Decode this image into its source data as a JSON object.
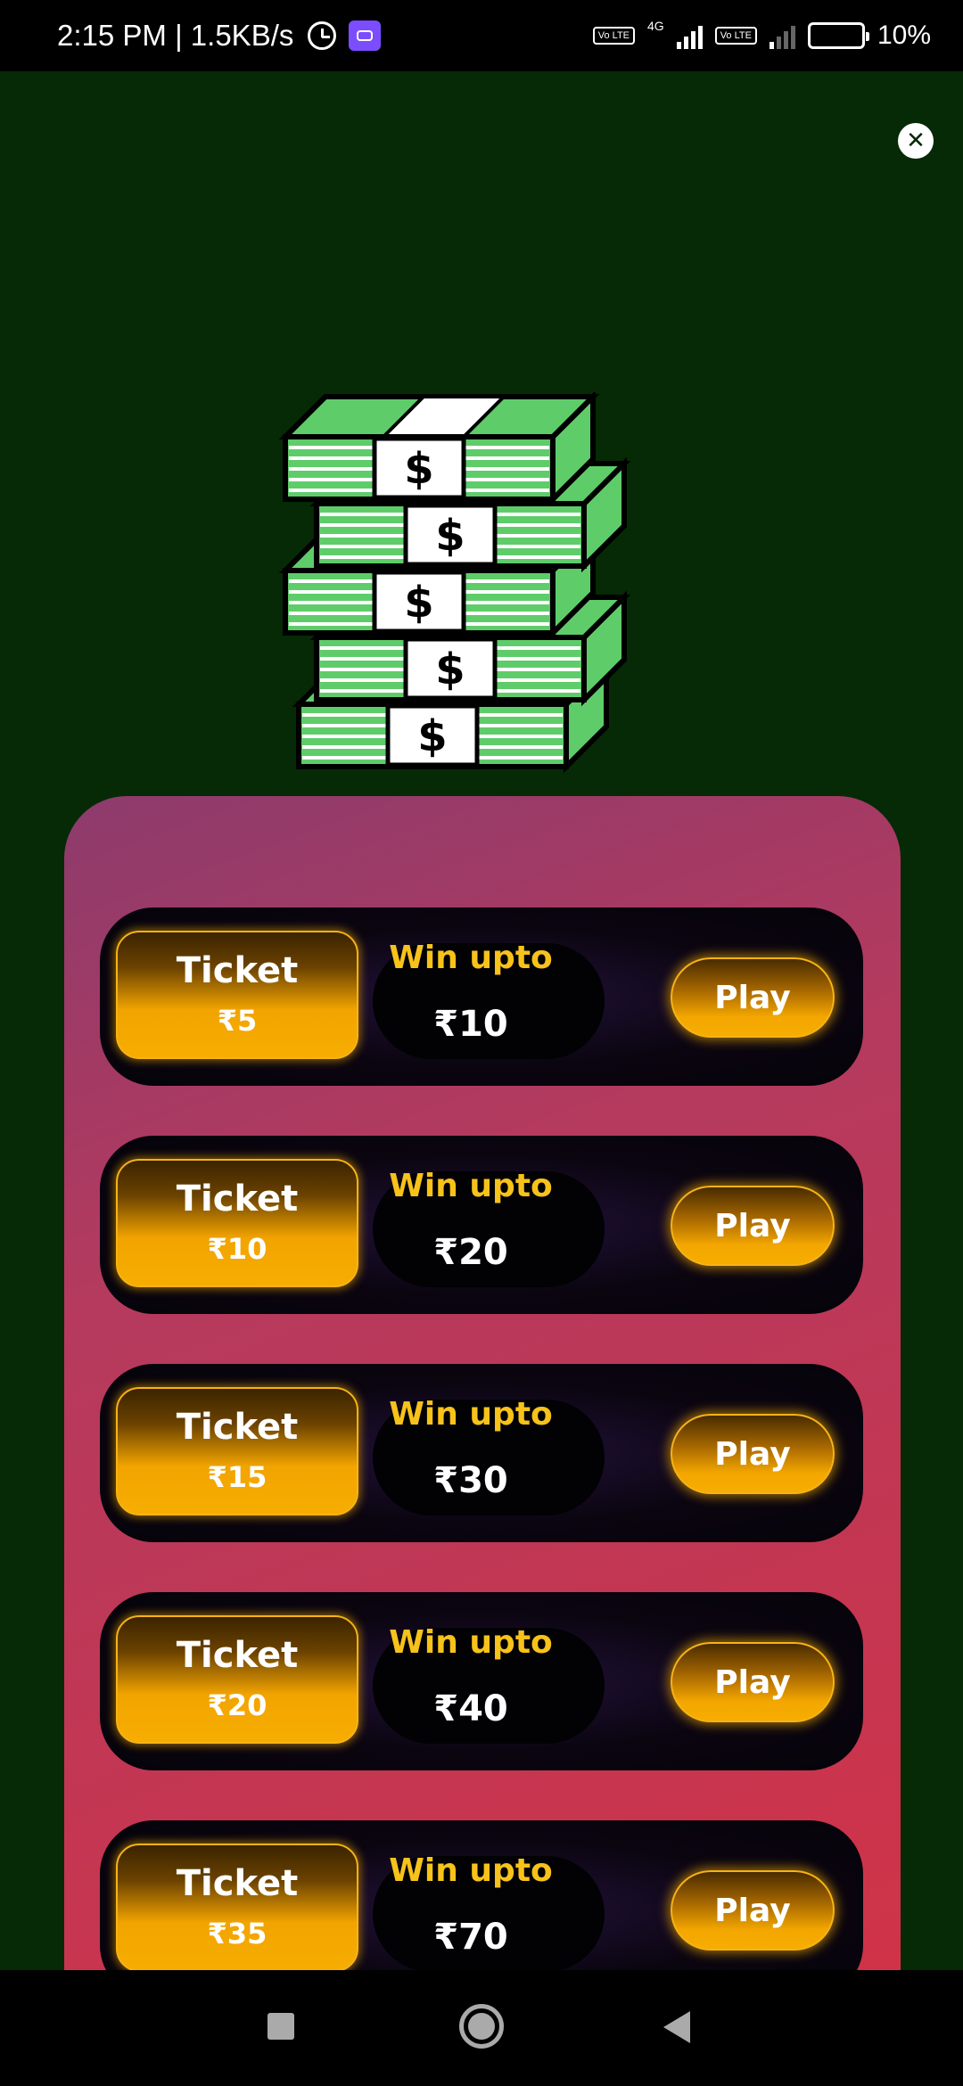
{
  "status_bar": {
    "time_speed": "2:15 PM | 1.5KB/s",
    "network_type": "4G",
    "volte_label": "Vo LTE",
    "battery": "10%",
    "battery_level": 0.1
  },
  "illustration": {
    "icon": "money-stack-icon",
    "symbol": "$"
  },
  "tickets": [
    {
      "ticket_label": "Ticket",
      "price": "₹5",
      "win_label": "Win upto",
      "win_amount": "₹10",
      "play_label": "Play"
    },
    {
      "ticket_label": "Ticket",
      "price": "₹10",
      "win_label": "Win upto",
      "win_amount": "₹20",
      "play_label": "Play"
    },
    {
      "ticket_label": "Ticket",
      "price": "₹15",
      "win_label": "Win upto",
      "win_amount": "₹30",
      "play_label": "Play"
    },
    {
      "ticket_label": "Ticket",
      "price": "₹20",
      "win_label": "Win upto",
      "win_amount": "₹40",
      "play_label": "Play"
    },
    {
      "ticket_label": "Ticket",
      "price": "₹35",
      "win_label": "Win upto",
      "win_amount": "₹70",
      "play_label": "Play"
    }
  ],
  "colors": {
    "background": "#062906",
    "accent_gold": "#f6ad00",
    "win_text": "#f7c21a",
    "money_green": "#5fcc6a"
  }
}
